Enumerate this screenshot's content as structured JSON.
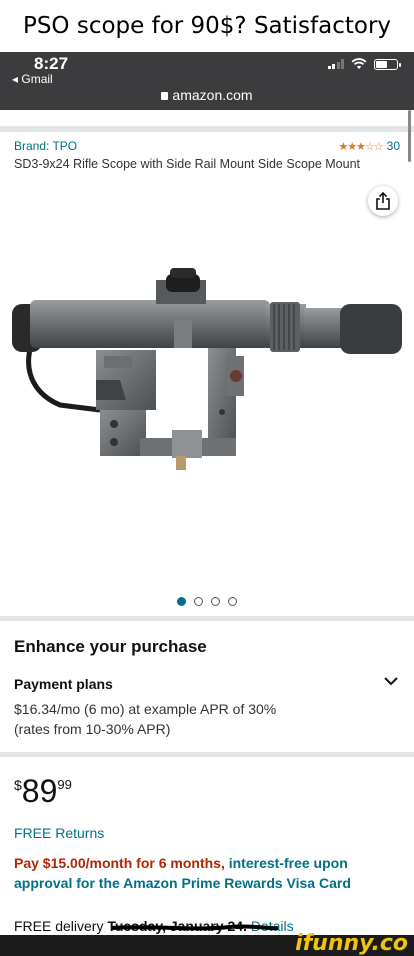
{
  "meme": {
    "title": "PSO scope for 90$? Satisfactory",
    "watermark": "ifunny.co"
  },
  "status_bar": {
    "time": "8:27",
    "back_app": "◂ Gmail",
    "url": "amazon.com"
  },
  "product": {
    "brand": "Brand: TPO",
    "rating_stars": "★★★☆☆",
    "rating_value": 3.5,
    "rating_count": "30",
    "title": "SD3-9x24 Rifle Scope with Side Rail Mount Side Scope Mount",
    "image_icon": "rifle-scope-photo",
    "carousel": {
      "total": 4,
      "active": 1
    }
  },
  "enhance": {
    "heading": "Enhance your purchase",
    "payment_plans_label": "Payment plans",
    "payment_plans_line1": "$16.34/mo (6 mo) at example APR of 30%",
    "payment_plans_line2": "(rates from 10-30% APR)"
  },
  "price": {
    "currency": "$",
    "whole": "89",
    "fraction": "99"
  },
  "free_returns": "FREE Returns",
  "promo": {
    "red": "Pay $15.00/month for 6 months,",
    "rest": " interest-free upon approval for the Amazon Prime Rewards Visa Card"
  },
  "delivery": {
    "prefix": "FREE delivery ",
    "date": "Tuesday, January 24.",
    "link": " Details"
  },
  "colors": {
    "link": "#007185",
    "price_red": "#b12704",
    "star": "#de7921",
    "statusbar": "#3c3c3e",
    "watermark": "#f4c20d"
  }
}
